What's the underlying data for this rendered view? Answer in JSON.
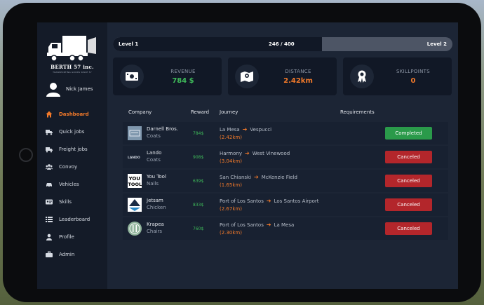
{
  "brand": {
    "name": "BERTH 57 inc.",
    "tagline": "TRANSPORTING GOODS SINCE 57"
  },
  "user": {
    "name": "Nick James"
  },
  "nav": [
    {
      "label": "Dashboard",
      "icon": "home-icon",
      "active": true
    },
    {
      "label": "Quick jobs",
      "icon": "truck-icon"
    },
    {
      "label": "Freight jobs",
      "icon": "truck-icon"
    },
    {
      "label": "Convoy",
      "icon": "group-icon"
    },
    {
      "label": "Vehicles",
      "icon": "vehicle-icon"
    },
    {
      "label": "Skills",
      "icon": "id-card-icon"
    },
    {
      "label": "Leaderboard",
      "icon": "list-icon"
    },
    {
      "label": "Profile",
      "icon": "user-icon"
    },
    {
      "label": "Admin",
      "icon": "briefcase-icon"
    }
  ],
  "progress": {
    "left_label": "Level 1",
    "center_label": "246 / 400",
    "right_label": "Level 2",
    "fraction": 0.615
  },
  "stats": [
    {
      "label": "REVENUE",
      "value": "784 $",
      "icon": "money-icon",
      "color": "#3fbb5a"
    },
    {
      "label": "DISTANCE",
      "value": "2.42km",
      "icon": "map-icon",
      "color": "#f37a2a"
    },
    {
      "label": "SKILLPOINTS",
      "value": "0",
      "icon": "award-icon",
      "color": "#f37a2a"
    }
  ],
  "table": {
    "headers": {
      "company": "Company",
      "reward": "Reward",
      "journey": "Journey",
      "requirements": "Requirements"
    },
    "rows": [
      {
        "company": "Darnell Bros.",
        "cargo": "Coats",
        "reward": "784$",
        "from": "La Mesa",
        "to": "Vespucci",
        "distance": "(2.42km)",
        "status": "Completed",
        "status_color": "#2a9a4a",
        "logo": "darnell-logo"
      },
      {
        "company": "Lando",
        "cargo": "Coats",
        "reward": "908$",
        "from": "Harmony",
        "to": "West Vinewood",
        "distance": "(3.04km)",
        "status": "Canceled",
        "status_color": "#b3262b",
        "logo": "lando-logo"
      },
      {
        "company": "You Tool",
        "cargo": "Nails",
        "reward": "639$",
        "from": "San Chianski",
        "to": "McKenzie Field",
        "distance": "(1.65km)",
        "status": "Canceled",
        "status_color": "#b3262b",
        "logo": "youtool-logo"
      },
      {
        "company": "Jetsam",
        "cargo": "Chicken",
        "reward": "833$",
        "from": "Port of Los Santos",
        "to": "Los Santos Airport",
        "distance": "(2.67km)",
        "status": "Canceled",
        "status_color": "#b3262b",
        "logo": "jetsam-logo"
      },
      {
        "company": "Krapea",
        "cargo": "Chairs",
        "reward": "760$",
        "from": "Port of Los Santos",
        "to": "La Mesa",
        "distance": "(2.30km)",
        "status": "Canceled",
        "status_color": "#b3262b",
        "logo": "krapea-logo"
      }
    ]
  }
}
